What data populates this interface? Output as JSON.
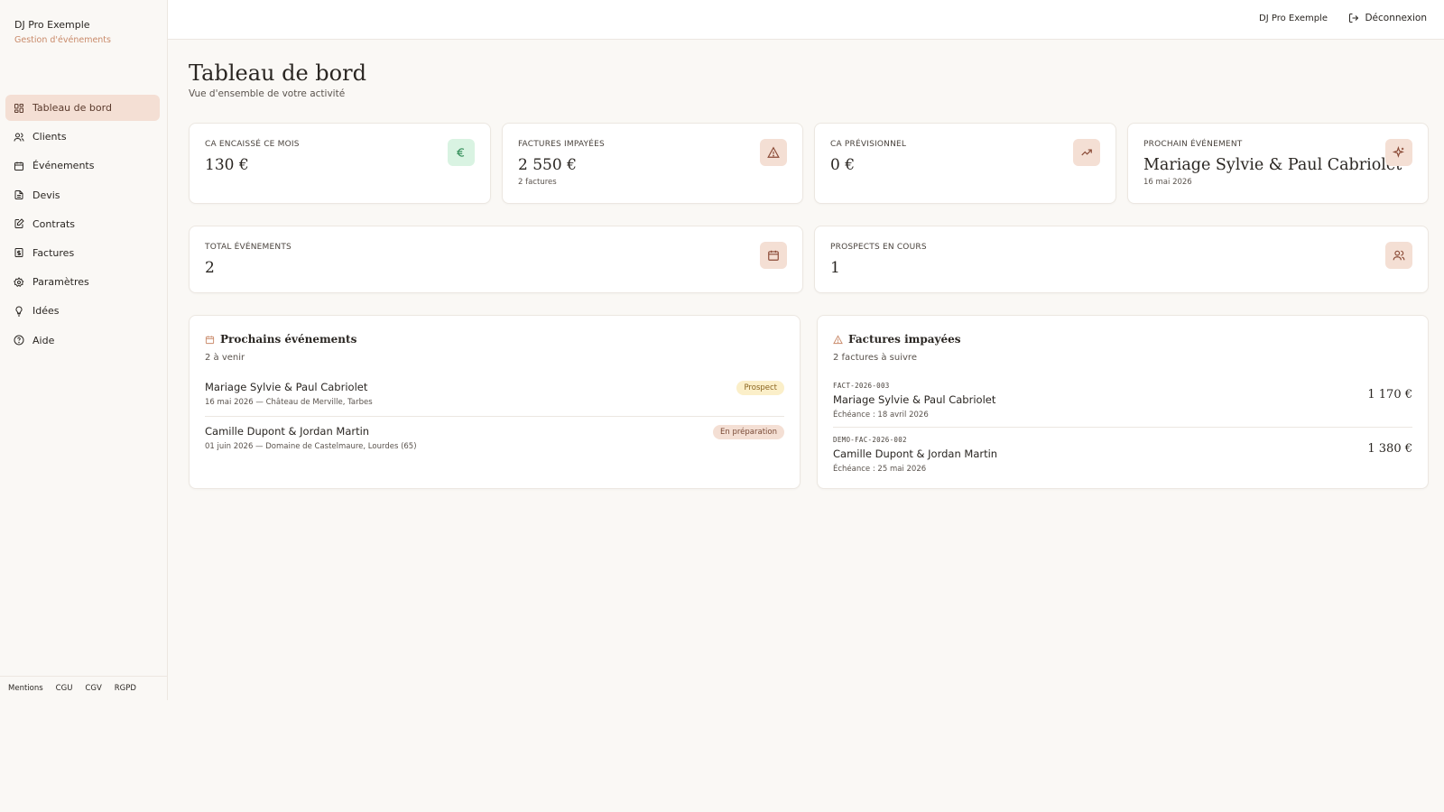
{
  "brand": {
    "name": "DJ Pro Exemple",
    "subtitle": "Gestion d'événements"
  },
  "nav": [
    {
      "label": "Tableau de bord",
      "icon": "dashboard-icon",
      "active": true
    },
    {
      "label": "Clients",
      "icon": "users-icon"
    },
    {
      "label": "Événements",
      "icon": "calendar-icon"
    },
    {
      "label": "Devis",
      "icon": "document-icon"
    },
    {
      "label": "Contrats",
      "icon": "pen-document-icon"
    },
    {
      "label": "Factures",
      "icon": "invoice-icon"
    },
    {
      "label": "Paramètres",
      "icon": "gear-icon"
    },
    {
      "label": "Idées",
      "icon": "lightbulb-icon"
    },
    {
      "label": "Aide",
      "icon": "help-icon"
    }
  ],
  "footer_links": [
    "Mentions",
    "CGU",
    "CGV",
    "RGPD"
  ],
  "topbar": {
    "user": "DJ Pro Exemple",
    "logout": "Déconnexion"
  },
  "page": {
    "title": "Tableau de bord",
    "subtitle": "Vue d'ensemble de votre activité"
  },
  "stats": {
    "ca_month": {
      "label": "CA ENCAISSÉ CE MOIS",
      "value": "130 €"
    },
    "unpaid": {
      "label": "FACTURES IMPAYÉES",
      "value": "2 550 €",
      "note": "2 factures"
    },
    "forecast": {
      "label": "CA PRÉVISIONNEL",
      "value": "0 €"
    },
    "next_event": {
      "label": "PROCHAIN ÉVÉNEMENT",
      "value": "Mariage Sylvie & Paul Cabriolet",
      "note": "16 mai 2026"
    },
    "total_events": {
      "label": "TOTAL ÉVÉNEMENTS",
      "value": "2"
    },
    "prospects": {
      "label": "PROSPECTS EN COURS",
      "value": "1"
    }
  },
  "upcoming": {
    "title": "Prochains événements",
    "subtitle": "2 à venir",
    "items": [
      {
        "title": "Mariage Sylvie & Paul Cabriolet",
        "meta": "16 mai 2026 — Château de Merville, Tarbes",
        "status": "Prospect"
      },
      {
        "title": "Camille Dupont & Jordan Martin",
        "meta": "01 juin 2026 — Domaine de Castelmaure, Lourdes (65)",
        "status": "En préparation"
      }
    ]
  },
  "invoices": {
    "title": "Factures impayées",
    "subtitle": "2 factures à suivre",
    "items": [
      {
        "code": "FACT-2026-003",
        "client": "Mariage Sylvie & Paul Cabriolet",
        "due": "Échéance : 18 avril 2026",
        "amount": "1 170 €"
      },
      {
        "code": "DEMO-FAC-2026-002",
        "client": "Camille Dupont & Jordan Martin",
        "due": "Échéance : 25 mai 2026",
        "amount": "1 380 €"
      }
    ]
  },
  "colors": {
    "accent": "#c98a6a",
    "accent_bg": "#f4dfd4",
    "green_bg": "#d9f3e2",
    "green": "#2f8a55"
  }
}
